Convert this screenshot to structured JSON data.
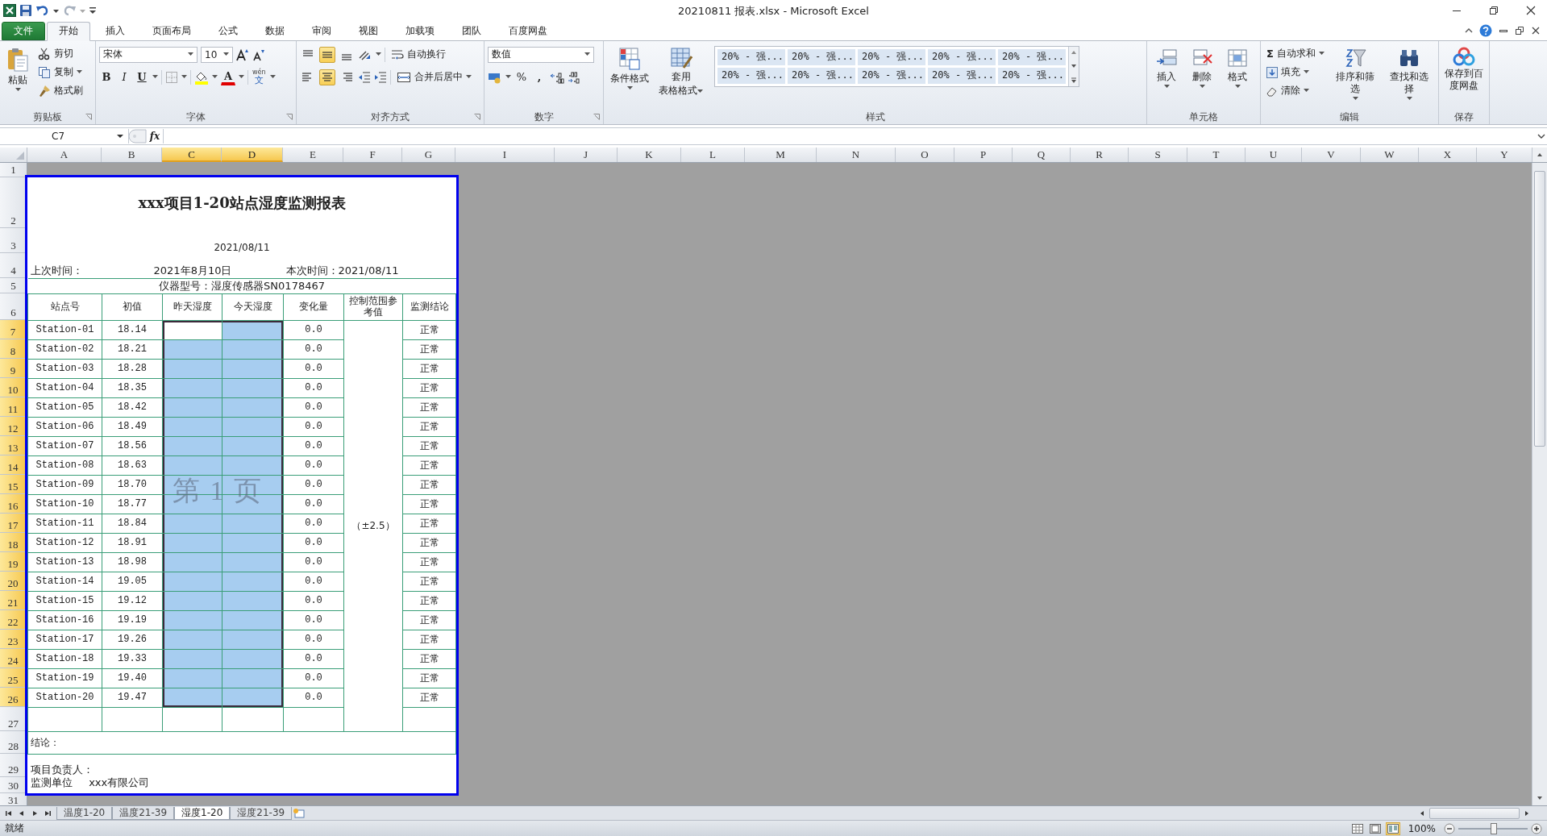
{
  "window": {
    "title": "20210811 报表.xlsx - Microsoft Excel"
  },
  "ribbon_tabs": [
    {
      "label": "文件",
      "kind": "file",
      "selected": false
    },
    {
      "label": "开始",
      "kind": "tab",
      "selected": true
    },
    {
      "label": "插入",
      "kind": "tab",
      "selected": false
    },
    {
      "label": "页面布局",
      "kind": "tab",
      "selected": false
    },
    {
      "label": "公式",
      "kind": "tab",
      "selected": false
    },
    {
      "label": "数据",
      "kind": "tab",
      "selected": false
    },
    {
      "label": "审阅",
      "kind": "tab",
      "selected": false
    },
    {
      "label": "视图",
      "kind": "tab",
      "selected": false
    },
    {
      "label": "加载项",
      "kind": "tab",
      "selected": false
    },
    {
      "label": "团队",
      "kind": "tab",
      "selected": false
    },
    {
      "label": "百度网盘",
      "kind": "tab",
      "selected": false
    }
  ],
  "clipboard": {
    "label": "剪贴板",
    "paste": "粘贴",
    "cut": "剪切",
    "copy": "复制",
    "format_painter": "格式刷"
  },
  "font": {
    "label": "字体",
    "name": "宋体",
    "size": "10",
    "bold": "B",
    "italic": "I",
    "underline": "U",
    "font_color": "A",
    "phonetic_top": "wén",
    "phonetic_bottom": "文"
  },
  "alignment": {
    "label": "对齐方式",
    "buttons": [
      {
        "kind": "top",
        "selected": false
      },
      {
        "kind": "middle",
        "selected": true
      },
      {
        "kind": "bottom",
        "selected": false
      },
      {
        "kind": "left",
        "selected": false
      },
      {
        "kind": "center",
        "selected": true
      },
      {
        "kind": "right",
        "selected": false
      }
    ],
    "wrap_text": "自动换行",
    "merge_center": "合并后居中"
  },
  "number": {
    "label": "数字",
    "format": "数值",
    "percent": "%",
    "comma": ","
  },
  "styles": {
    "label": "样式",
    "conditional_format": "条件格式",
    "format_as_table_top": "套用",
    "format_as_table_bottom": "表格格式",
    "cell_styles": [
      "20% - 强...",
      "20% - 强...",
      "20% - 强...",
      "20% - 强...",
      "20% - 强...",
      "20% - 强...",
      "20% - 强...",
      "20% - 强...",
      "20% - 强...",
      "20% - 强..."
    ]
  },
  "cells": {
    "label": "单元格",
    "insert": "插入",
    "delete": "删除",
    "format": "格式"
  },
  "editing": {
    "label": "编辑",
    "autosum_symbol": "Σ",
    "autosum": "自动求和",
    "fill": "填充",
    "clear": "清除",
    "sort_filter": "排序和筛选",
    "find_select": "查找和选择"
  },
  "save": {
    "label": "保存",
    "save_to_cloud": "保存到百度网盘"
  },
  "formula_bar": {
    "name_box": "C7",
    "function_label": "fx"
  },
  "sheet": {
    "columns": [
      {
        "label": "A",
        "selected": false
      },
      {
        "label": "B",
        "selected": false
      },
      {
        "label": "C",
        "selected": true
      },
      {
        "label": "D",
        "selected": true
      },
      {
        "label": "E",
        "selected": false
      },
      {
        "label": "F",
        "selected": false
      },
      {
        "label": "G",
        "selected": false
      },
      {
        "label": "I",
        "selected": false
      },
      {
        "label": "J",
        "selected": false
      },
      {
        "label": "K",
        "selected": false
      },
      {
        "label": "L",
        "selected": false
      },
      {
        "label": "M",
        "selected": false
      },
      {
        "label": "N",
        "selected": false
      },
      {
        "label": "O",
        "selected": false
      },
      {
        "label": "P",
        "selected": false
      },
      {
        "label": "Q",
        "selected": false
      },
      {
        "label": "R",
        "selected": false
      },
      {
        "label": "S",
        "selected": false
      },
      {
        "label": "T",
        "selected": false
      },
      {
        "label": "U",
        "selected": false
      },
      {
        "label": "V",
        "selected": false
      },
      {
        "label": "W",
        "selected": false
      },
      {
        "label": "X",
        "selected": false
      },
      {
        "label": "Y",
        "selected": false
      }
    ],
    "row_headers": [
      {
        "label": "1",
        "selected": false
      },
      {
        "label": "2",
        "selected": false
      },
      {
        "label": "3",
        "selected": false
      },
      {
        "label": "4",
        "selected": false
      },
      {
        "label": "5",
        "selected": false
      },
      {
        "label": "6",
        "selected": false
      },
      {
        "label": "7",
        "selected": true
      },
      {
        "label": "8",
        "selected": true
      },
      {
        "label": "9",
        "selected": true
      },
      {
        "label": "10",
        "selected": true
      },
      {
        "label": "11",
        "selected": true
      },
      {
        "label": "12",
        "selected": true
      },
      {
        "label": "13",
        "selected": true
      },
      {
        "label": "14",
        "selected": true
      },
      {
        "label": "15",
        "selected": true
      },
      {
        "label": "16",
        "selected": true
      },
      {
        "label": "17",
        "selected": true
      },
      {
        "label": "18",
        "selected": true
      },
      {
        "label": "19",
        "selected": true
      },
      {
        "label": "20",
        "selected": true
      },
      {
        "label": "21",
        "selected": true
      },
      {
        "label": "22",
        "selected": true
      },
      {
        "label": "23",
        "selected": true
      },
      {
        "label": "24",
        "selected": true
      },
      {
        "label": "25",
        "selected": true
      },
      {
        "label": "26",
        "selected": true
      },
      {
        "label": "27",
        "selected": false
      },
      {
        "label": "28",
        "selected": false
      },
      {
        "label": "29",
        "selected": false
      },
      {
        "label": "30",
        "selected": false
      },
      {
        "label": "31",
        "selected": false
      }
    ]
  },
  "report": {
    "title": "xxx项目1-20站点湿度监测报表",
    "date": "2021/08/11",
    "last_time_label": "上次时间：",
    "last_time": "2021年8月10日",
    "this_time": "本次时间：2021/08/11",
    "instrument": "仪器型号：湿度传感器SN0178467",
    "headers": [
      "站点号",
      "初值",
      "昨天湿度",
      "今天湿度",
      "变化量",
      "控制范围参考值",
      "监测结论"
    ],
    "rows": [
      {
        "station": "Station-01",
        "initial": "18.14",
        "change": "0.0",
        "result": "正常"
      },
      {
        "station": "Station-02",
        "initial": "18.21",
        "change": "0.0",
        "result": "正常"
      },
      {
        "station": "Station-03",
        "initial": "18.28",
        "change": "0.0",
        "result": "正常"
      },
      {
        "station": "Station-04",
        "initial": "18.35",
        "change": "0.0",
        "result": "正常"
      },
      {
        "station": "Station-05",
        "initial": "18.42",
        "change": "0.0",
        "result": "正常"
      },
      {
        "station": "Station-06",
        "initial": "18.49",
        "change": "0.0",
        "result": "正常"
      },
      {
        "station": "Station-07",
        "initial": "18.56",
        "change": "0.0",
        "result": "正常"
      },
      {
        "station": "Station-08",
        "initial": "18.63",
        "change": "0.0",
        "result": "正常"
      },
      {
        "station": "Station-09",
        "initial": "18.70",
        "change": "0.0",
        "result": "正常"
      },
      {
        "station": "Station-10",
        "initial": "18.77",
        "change": "0.0",
        "result": "正常"
      },
      {
        "station": "Station-11",
        "initial": "18.84",
        "change": "0.0",
        "result": "正常"
      },
      {
        "station": "Station-12",
        "initial": "18.91",
        "change": "0.0",
        "result": "正常"
      },
      {
        "station": "Station-13",
        "initial": "18.98",
        "change": "0.0",
        "result": "正常"
      },
      {
        "station": "Station-14",
        "initial": "19.05",
        "change": "0.0",
        "result": "正常"
      },
      {
        "station": "Station-15",
        "initial": "19.12",
        "change": "0.0",
        "result": "正常"
      },
      {
        "station": "Station-16",
        "initial": "19.19",
        "change": "0.0",
        "result": "正常"
      },
      {
        "station": "Station-17",
        "initial": "19.26",
        "change": "0.0",
        "result": "正常"
      },
      {
        "station": "Station-18",
        "initial": "19.33",
        "change": "0.0",
        "result": "正常"
      },
      {
        "station": "Station-19",
        "initial": "19.40",
        "change": "0.0",
        "result": "正常"
      },
      {
        "station": "Station-20",
        "initial": "19.47",
        "change": "0.0",
        "result": "正常"
      }
    ],
    "control_range": "（±2.5）",
    "conclusion": "结论：",
    "project_lead": "项目负责人：",
    "monitoring_unit": "监测单位     xxx有限公司",
    "page_label": "第 1 页"
  },
  "sheet_tabs": [
    {
      "label": "温度1-20",
      "selected": false
    },
    {
      "label": "温度21-39",
      "selected": false
    },
    {
      "label": "湿度1-20",
      "selected": true
    },
    {
      "label": "湿度21-39",
      "selected": false
    }
  ],
  "status_bar": {
    "status": "就绪",
    "view_buttons": [
      {
        "kind": "normal",
        "selected": false
      },
      {
        "kind": "layout",
        "selected": false
      },
      {
        "kind": "page_break",
        "selected": true
      }
    ],
    "zoom": "100%",
    "zoom_slider": {
      "level": 0.5
    }
  }
}
